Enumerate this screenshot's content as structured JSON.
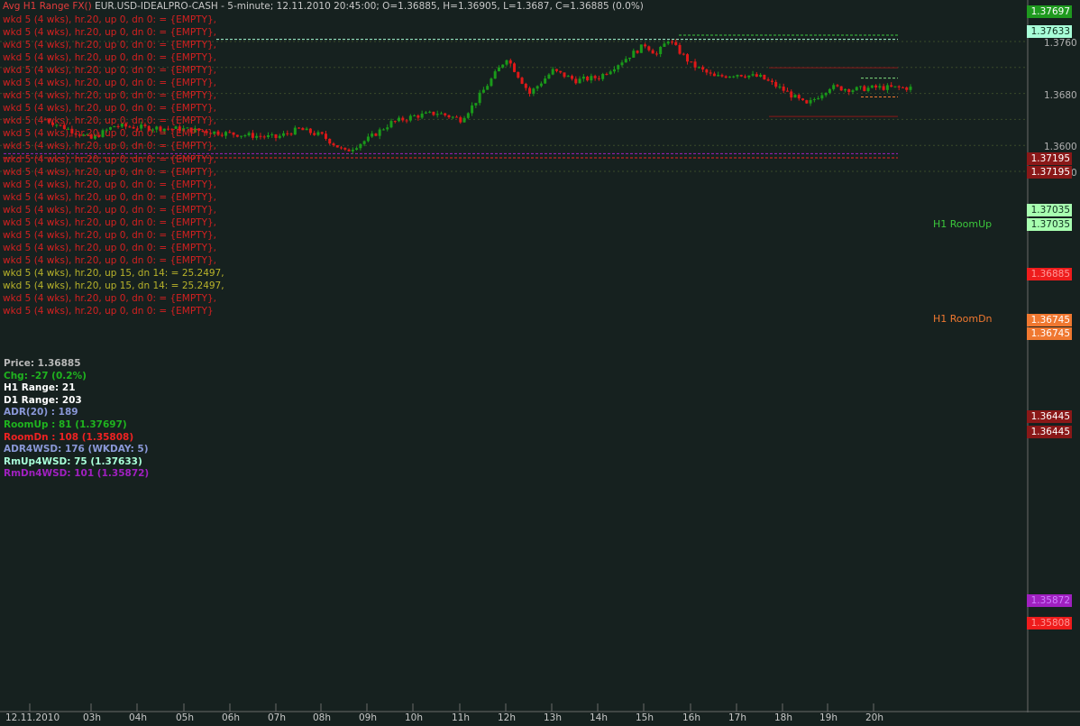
{
  "title": {
    "indicator": "Avg H1 Range FX()",
    "text": "EUR.USD-IDEALPRO-CASH - 5-minute; 12.11.2010 20:45:00; O=1.36885, H=1.36905, L=1.3687, C=1.36885 (0.0%)"
  },
  "log_lines": [
    "wkd 5 (4 wks), hr.20, up 0, dn 0: = {EMPTY},",
    "wkd 5 (4 wks), hr.20, up 0, dn 0: = {EMPTY},",
    "wkd 5 (4 wks), hr.20, up 0, dn 0: = {EMPTY},",
    "wkd 5 (4 wks), hr.20, up 0, dn 0: = {EMPTY},",
    "wkd 5 (4 wks), hr.20, up 0, dn 0: = {EMPTY},",
    "wkd 5 (4 wks), hr.20, up 0, dn 0: = {EMPTY},",
    "wkd 5 (4 wks), hr.20, up 0, dn 0: = {EMPTY},",
    "wkd 5 (4 wks), hr.20, up 0, dn 0: = {EMPTY},",
    "wkd 5 (4 wks), hr.20, up 0, dn 0: = {EMPTY},",
    "wkd 5 (4 wks), hr.20, up 0, dn 0: = {EMPTY},",
    "wkd 5 (4 wks), hr.20, up 0, dn 0: = {EMPTY},",
    "wkd 5 (4 wks), hr.20, up 0, dn 0: = {EMPTY},",
    "wkd 5 (4 wks), hr.20, up 0, dn 0: = {EMPTY},",
    "wkd 5 (4 wks), hr.20, up 0, dn 0: = {EMPTY},",
    "wkd 5 (4 wks), hr.20, up 0, dn 0: = {EMPTY},",
    "wkd 5 (4 wks), hr.20, up 0, dn 0: = {EMPTY},",
    "wkd 5 (4 wks), hr.20, up 0, dn 0: = {EMPTY},",
    "wkd 5 (4 wks), hr.20, up 0, dn 0: = {EMPTY},",
    "wkd 5 (4 wks), hr.20, up 0, dn 0: = {EMPTY},",
    "wkd 5 (4 wks), hr.20, up 0, dn 0: = {EMPTY},",
    "wkd 5 (4 wks), hr.20, up 15, dn 14: = 25.2497,",
    "wkd 5 (4 wks), hr.20, up 15, dn 14: = 25.2497,",
    "wkd 5 (4 wks), hr.20, up 0, dn 0: = {EMPTY},",
    "wkd 5 (4 wks), hr.20, up 0, dn 0: = {EMPTY}"
  ],
  "log_colors": [
    "#d42020",
    "#d42020",
    "#d42020",
    "#d42020",
    "#d42020",
    "#d42020",
    "#d42020",
    "#d42020",
    "#d42020",
    "#d42020",
    "#d42020",
    "#d42020",
    "#d42020",
    "#d42020",
    "#d42020",
    "#d42020",
    "#d42020",
    "#d42020",
    "#d42020",
    "#d42020",
    "#b8b22a",
    "#b8b22a",
    "#d42020",
    "#d42020"
  ],
  "stats": [
    {
      "text": "Price: 1.36885",
      "color": "#b8b8b8"
    },
    {
      "text": "Chg: -27 (0.2%)",
      "color": "#1fb31f"
    },
    {
      "text": "H1 Range: 21",
      "color": "#ffffff"
    },
    {
      "text": "D1 Range: 203",
      "color": "#ffffff"
    },
    {
      "text": "ADR(20) : 189",
      "color": "#8a98d8"
    },
    {
      "text": "RoomUp : 81 (1.37697)",
      "color": "#1fb31f"
    },
    {
      "text": "RoomDn : 108 (1.35808)",
      "color": "#ee2222"
    },
    {
      "text": "ADR4WSD: 176 (WKDAY: 5)",
      "color": "#8a98d8"
    },
    {
      "text": "RmUp4WSD: 75 (1.37633)",
      "color": "#a8ffd8"
    },
    {
      "text": "RmDn4WSD: 101 (1.35872)",
      "color": "#a020c0"
    }
  ],
  "room_labels": {
    "up": "H1 RoomUp",
    "down": "H1 RoomDn"
  },
  "axis_prices": [
    "1.3760",
    "1.3680",
    "1.3600",
    "1.3560"
  ],
  "price_tags": [
    {
      "text": "1.37697",
      "bg": "#1f9a1f",
      "fg": "#ffffff"
    },
    {
      "text": "1.37633",
      "bg": "#a8ffd8",
      "fg": "#103020"
    },
    {
      "text": "1.37195",
      "bg": "#8a1818",
      "fg": "#ffffff"
    },
    {
      "text": "1.37195",
      "bg": "#8a1818",
      "fg": "#ffffff"
    },
    {
      "text": "1.37035",
      "bg": "#a8ffb0",
      "fg": "#103020"
    },
    {
      "text": "1.37035",
      "bg": "#a8ffb0",
      "fg": "#103020"
    },
    {
      "text": "1.36885",
      "bg": "#ee1c1c",
      "fg": "#ff9a9a"
    },
    {
      "text": "1.36745",
      "bg": "#f07830",
      "fg": "#ffffff"
    },
    {
      "text": "1.36745",
      "bg": "#f07830",
      "fg": "#ffffff"
    },
    {
      "text": "1.36445",
      "bg": "#8a1818",
      "fg": "#ffffff"
    },
    {
      "text": "1.36445",
      "bg": "#8a1818",
      "fg": "#ffffff"
    },
    {
      "text": "1.35872",
      "bg": "#a020c0",
      "fg": "#d080ff"
    },
    {
      "text": "1.35808",
      "bg": "#ee1c1c",
      "fg": "#ff9a9a"
    }
  ],
  "time_labels": [
    "12.11.2010",
    "03h",
    "04h",
    "05h",
    "06h",
    "07h",
    "08h",
    "09h",
    "10h",
    "11h",
    "12h",
    "13h",
    "14h",
    "15h",
    "16h",
    "17h",
    "18h",
    "19h",
    "20h"
  ],
  "colors": {
    "background": "#16211f",
    "up_candle": "#1a9a1a",
    "down_candle": "#e01818",
    "grid": "#3a4a2a",
    "room_up": "#7fdc7f",
    "room_dn": "#f07830"
  },
  "chart_data": {
    "type": "candlestick",
    "instrument": "EUR.USD-IDEALPRO-CASH",
    "interval": "5-minute",
    "ohlc_last": {
      "open": 1.36885,
      "high": 1.36905,
      "low": 1.3687,
      "close": 1.36885
    },
    "levels": {
      "room_up": 1.37697,
      "rm_up_4wsd": 1.37633,
      "h1_level_a": 1.37195,
      "h1_room_up": 1.37035,
      "last": 1.36885,
      "h1_room_dn": 1.36745,
      "h1_level_b": 1.36445,
      "rm_dn_4wsd": 1.35872,
      "room_dn": 1.35808
    },
    "close_path_hours": [
      "02:00",
      "03:00",
      "03:30",
      "04:00",
      "05:00",
      "06:00",
      "07:00",
      "07:30",
      "08:00",
      "08:30",
      "09:00",
      "09:30",
      "10:00",
      "10:30",
      "11:00",
      "11:15",
      "11:30",
      "12:00",
      "12:30",
      "13:00",
      "13:30",
      "14:00",
      "14:30",
      "15:00",
      "15:15",
      "15:30",
      "16:00",
      "16:30",
      "17:00",
      "17:30",
      "18:00",
      "18:30",
      "19:00",
      "19:30",
      "20:00",
      "20:45"
    ],
    "close_path": [
      1.364,
      1.361,
      1.363,
      1.3628,
      1.3625,
      1.3618,
      1.3612,
      1.3625,
      1.3615,
      1.359,
      1.361,
      1.3635,
      1.3645,
      1.365,
      1.364,
      1.366,
      1.3685,
      1.3735,
      1.368,
      1.3715,
      1.37,
      1.3705,
      1.373,
      1.3755,
      1.374,
      1.3763,
      1.3725,
      1.3705,
      1.371,
      1.3705,
      1.3685,
      1.3662,
      1.369,
      1.3686,
      1.3689,
      1.36885
    ]
  }
}
